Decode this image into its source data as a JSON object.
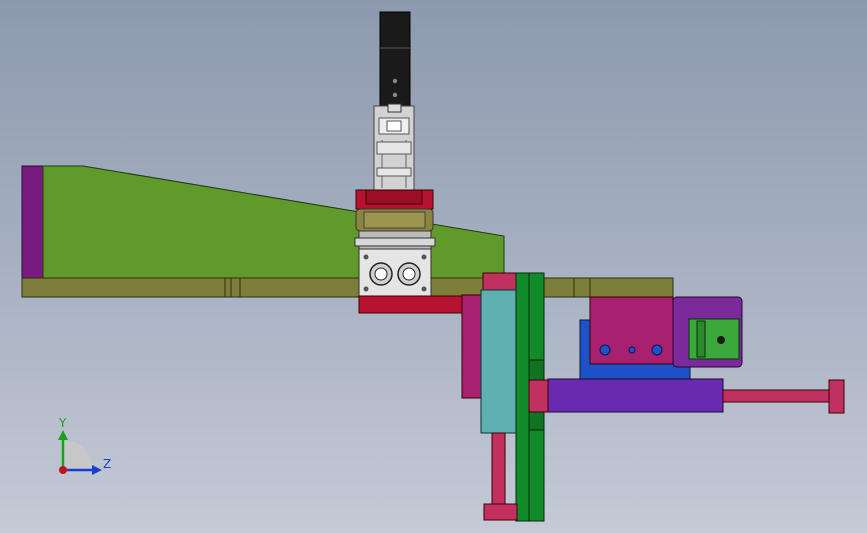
{
  "viewport": {
    "background_top": "#8d99ae",
    "background_bottom": "#c4cad6"
  },
  "triad": {
    "y_label": "Y",
    "z_label": "Z",
    "y_color": "#1aa01a",
    "z_color": "#1a3fd0",
    "origin_color": "#c0141c"
  },
  "colors": {
    "plate_green": "#5f9a2a",
    "rail_olive": "#7d7e3a",
    "purple": "#7a1b82",
    "red": "#b5132e",
    "magenta": "#a82070",
    "teal": "#5fb0b0",
    "dark_green": "#138a2a",
    "blue": "#1f52c8",
    "violet": "#6a2ab0",
    "gray_body": "#c8c8c8",
    "black_motor": "#1a1a1a"
  }
}
